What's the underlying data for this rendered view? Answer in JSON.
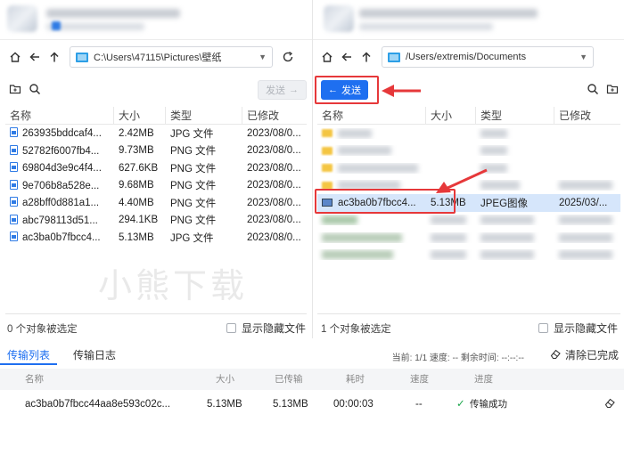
{
  "left_panel": {
    "path": "C:\\Users\\47115\\Pictures\\壁纸",
    "send_label": "发送",
    "columns": [
      "名称",
      "大小",
      "类型",
      "已修改"
    ],
    "files": [
      {
        "name": "263935bddcaf4...",
        "size": "2.42MB",
        "type": "JPG 文件",
        "modified": "2023/08/0..."
      },
      {
        "name": "52782f6007fb4...",
        "size": "9.73MB",
        "type": "PNG 文件",
        "modified": "2023/08/0..."
      },
      {
        "name": "69804d3e9c4f4...",
        "size": "627.6KB",
        "type": "PNG 文件",
        "modified": "2023/08/0..."
      },
      {
        "name": "9e706b8a528e...",
        "size": "9.68MB",
        "type": "PNG 文件",
        "modified": "2023/08/0..."
      },
      {
        "name": "a28bff0d881a1...",
        "size": "4.40MB",
        "type": "PNG 文件",
        "modified": "2023/08/0..."
      },
      {
        "name": "abc798113d51...",
        "size": "294.1KB",
        "type": "PNG 文件",
        "modified": "2023/08/0..."
      },
      {
        "name": "ac3ba0b7fbcc4...",
        "size": "5.13MB",
        "type": "JPG 文件",
        "modified": "2023/08/0..."
      }
    ],
    "status": "0 个对象被选定",
    "show_hidden": "显示隐藏文件"
  },
  "right_panel": {
    "path": "/Users/extremis/Documents",
    "send_label": "发送",
    "columns": [
      "名称",
      "大小",
      "类型",
      "已修改"
    ],
    "selected_file": {
      "name": "ac3ba0b7fbcc4...",
      "size": "5.13MB",
      "type": "JPEG图像",
      "modified": "2025/03/..."
    },
    "status": "1 个对象被选定",
    "show_hidden": "显示隐藏文件"
  },
  "watermark": "小熊下载",
  "transfer": {
    "tabs": [
      "传输列表",
      "传输日志"
    ],
    "info": "当前: 1/1   速度: --   剩余时间: --:--:--",
    "clear_label": "清除已完成",
    "columns": [
      "名称",
      "大小",
      "已传输",
      "耗时",
      "速度",
      "进度"
    ],
    "row": {
      "name": "ac3ba0b7fbcc44aa8e593c02c...",
      "size": "5.13MB",
      "transferred": "5.13MB",
      "elapsed": "00:00:03",
      "speed": "--",
      "progress": "传输成功"
    }
  },
  "colors": {
    "accent": "#1e6ff0",
    "highlight": "#e6383a",
    "success": "#1aa64a"
  }
}
